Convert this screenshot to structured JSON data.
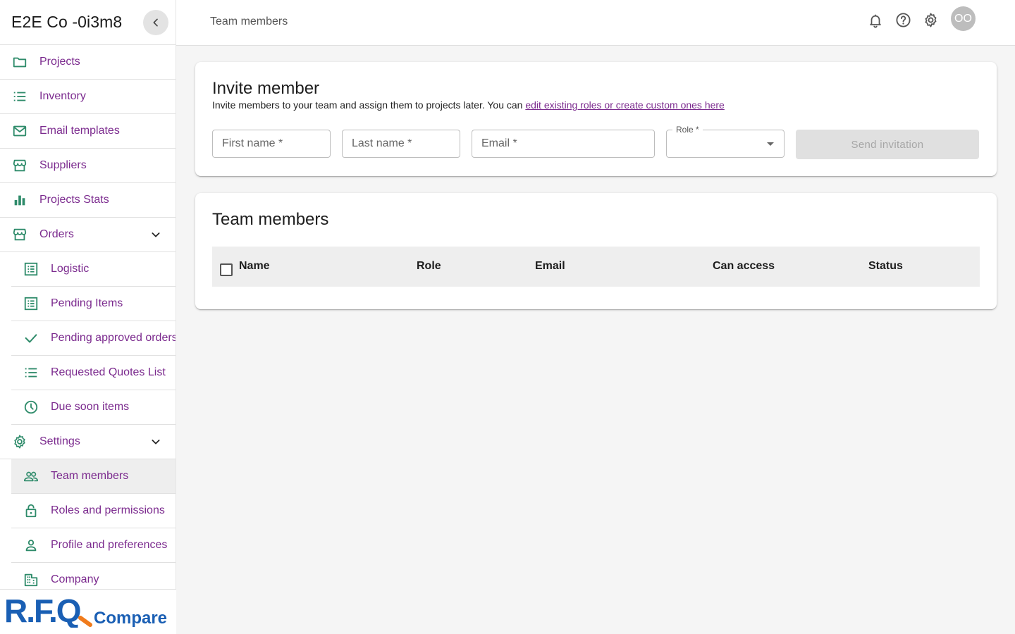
{
  "sidebar": {
    "company_name": "E2E Co -0i3m8",
    "items": [
      {
        "label": "Projects"
      },
      {
        "label": "Inventory"
      },
      {
        "label": "Email templates"
      },
      {
        "label": "Suppliers"
      },
      {
        "label": "Projects Stats"
      },
      {
        "label": "Orders"
      },
      {
        "label": "Logistic"
      },
      {
        "label": "Pending Items"
      },
      {
        "label": "Pending approved orders"
      },
      {
        "label": "Requested Quotes List"
      },
      {
        "label": "Due soon items"
      },
      {
        "label": "Settings"
      },
      {
        "label": "Team members"
      },
      {
        "label": "Roles and permissions"
      },
      {
        "label": "Profile and preferences"
      },
      {
        "label": "Company"
      }
    ],
    "logo": {
      "main": "R.F.Q",
      "sub": "Compare"
    }
  },
  "header": {
    "breadcrumb": "Team members",
    "avatar_initials": "OO",
    "icons": [
      "bell-icon",
      "help-icon",
      "gear-icon"
    ]
  },
  "invite": {
    "title": "Invite member",
    "description": "Invite members to your team and assign them to projects later. You can ",
    "link_text": "edit existing roles or create custom ones here",
    "first_name_placeholder": "First name *",
    "last_name_placeholder": "Last name *",
    "email_placeholder": "Email *",
    "role_label": "Role *",
    "role_value": "",
    "send_button": "Send invitation"
  },
  "team": {
    "title": "Team members",
    "columns": [
      "Name",
      "Role",
      "Email",
      "Can access",
      "Status"
    ],
    "rows": []
  },
  "colors": {
    "accent": "#7b2a8e",
    "icon_green": "#2e8b6a",
    "logo_blue": "#1a5fb4",
    "logo_orange": "#f07b1c"
  }
}
